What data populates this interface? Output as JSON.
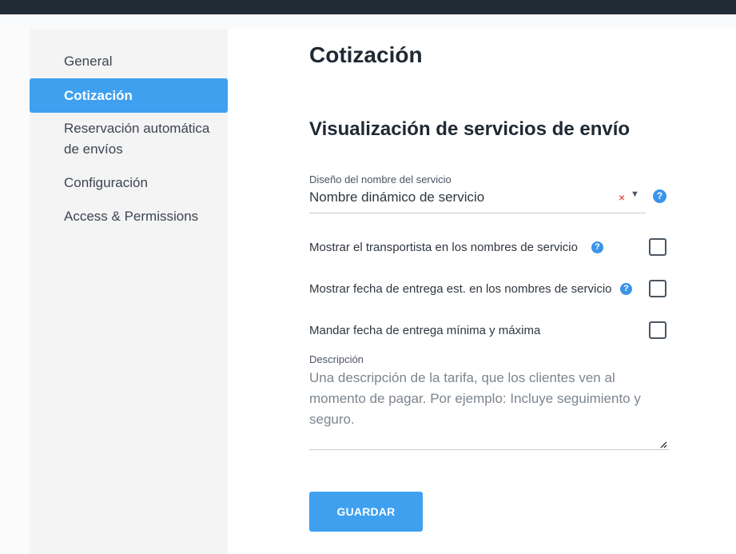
{
  "sidebar": {
    "items": [
      {
        "label": "General",
        "active": false
      },
      {
        "label": "Cotización",
        "active": true
      },
      {
        "label": "Reservación automática de envíos",
        "label_line1": "Reservación automática",
        "label_line2": "de envíos",
        "active": false
      },
      {
        "label": "Configuración",
        "active": false
      },
      {
        "label": "Access & Permissions",
        "active": false
      }
    ]
  },
  "main": {
    "page_title": "Cotización",
    "section_title": "Visualización de servicios de envío",
    "service_name_field": {
      "label": "Diseño del nombre del servicio",
      "value": "Nombre dinámico de servicio",
      "clear_icon": "close-icon",
      "caret_icon": "caret-down-icon",
      "help_icon": "help-icon"
    },
    "options": [
      {
        "label": "Mostrar el transportista en los nombres de servicio",
        "has_help": true,
        "checked": false
      },
      {
        "label": "Mostrar fecha de entrega est. en los nombres de servicio",
        "has_help": true,
        "checked": false
      },
      {
        "label": "Mandar fecha de entrega mínima y máxima",
        "has_help": false,
        "checked": false
      }
    ],
    "description": {
      "label": "Descripción",
      "placeholder": "Una descripción de la tarifa, que los clientes ven al momento de pagar. Por ejemplo: Incluye seguimiento y seguro."
    },
    "save_button_label": "GUARDAR"
  },
  "colors": {
    "accent": "#3fa0f0",
    "topbar": "#212b36",
    "sidebar_bg": "#f4f4f5",
    "help_icon": "#3b94e8",
    "clear_icon": "#e02424"
  }
}
